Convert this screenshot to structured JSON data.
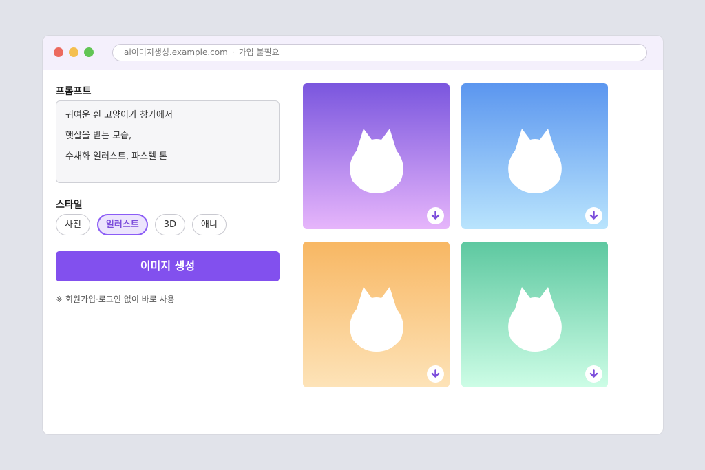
{
  "browser": {
    "url": "ai이미지생성.example.com",
    "separator": "·",
    "url_note": "가입 불필요"
  },
  "prompt": {
    "label": "프롬프트",
    "lines": [
      "귀여운 흰 고양이가 창가에서",
      "햇살을 받는 모습,",
      "수채화 일러스트, 파스텔 톤"
    ]
  },
  "style": {
    "label": "스타일",
    "options": [
      "사진",
      "일러스트",
      "3D",
      "애니"
    ],
    "selected": "일러스트"
  },
  "generate_label": "이미지 생성",
  "note": "※ 회원가입·로그인 없이 바로 사용",
  "results": {
    "images": [
      {
        "icon": "cat-silhouette-icon",
        "gradient": [
          "#7a56de",
          "#e6b5fb"
        ]
      },
      {
        "icon": "cat-silhouette-icon",
        "gradient": [
          "#5b96ef",
          "#b9e4fd"
        ]
      },
      {
        "icon": "cat-silhouette-icon",
        "gradient": [
          "#f8b763",
          "#fde3b8"
        ]
      },
      {
        "icon": "cat-silhouette-icon",
        "gradient": [
          "#5dc8a0",
          "#cdfde6"
        ]
      }
    ],
    "download_icon": "download-icon"
  },
  "colors": {
    "accent": "#8250ee",
    "accent_text": "#7c4ddb",
    "chip_active_bg": "#ece4fd"
  }
}
